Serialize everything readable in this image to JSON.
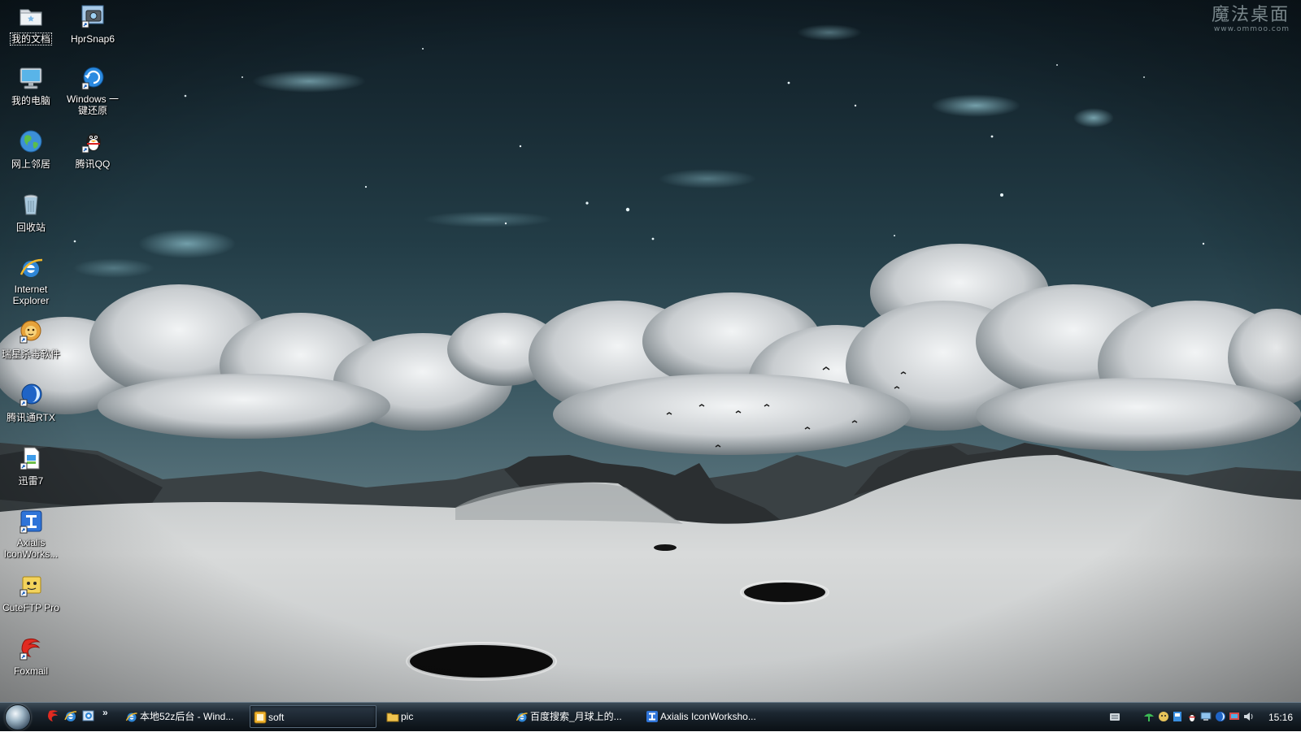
{
  "desktop": {
    "watermark": {
      "title": "魔法桌面",
      "site": "www.ommoo.com"
    },
    "icons": [
      {
        "label": "我的文档"
      },
      {
        "label": "HprSnap6"
      },
      {
        "label": "我的电脑"
      },
      {
        "label": "Windows 一键还原"
      },
      {
        "label": "网上邻居"
      },
      {
        "label": "腾讯QQ"
      },
      {
        "label": "回收站"
      },
      {
        "label": "Internet Explorer"
      },
      {
        "label": "瑞星杀毒软件"
      },
      {
        "label": "腾讯通RTX"
      },
      {
        "label": "迅雷7"
      },
      {
        "label": "Axialis IconWorks..."
      },
      {
        "label": "CuteFTP Pro"
      },
      {
        "label": "Foxmail"
      }
    ]
  },
  "taskbar": {
    "quick_launch_more": "»",
    "tasks": [
      {
        "label": "本地52z后台 - Wind...",
        "icon": "ie-icon"
      },
      {
        "label": "soft",
        "icon": "folder-icon"
      },
      {
        "label": "pic",
        "icon": "folder-icon"
      },
      {
        "label": "百度搜索_月球上的...",
        "icon": "ie-icon"
      },
      {
        "label": "Axialis IconWorksho...",
        "icon": "axialis-icon"
      }
    ],
    "clock": "15:16"
  }
}
